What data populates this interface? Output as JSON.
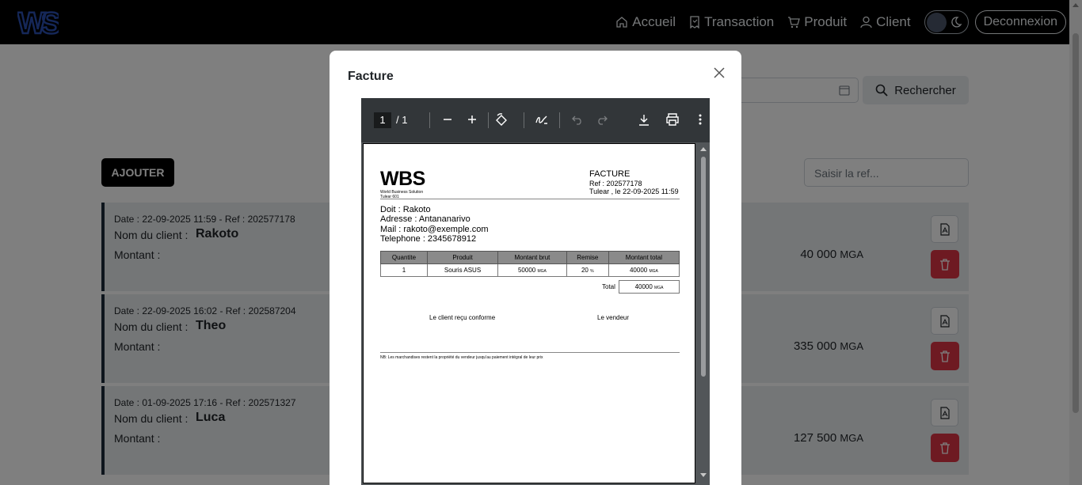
{
  "navbar": {
    "logo_text": "WS",
    "links": [
      {
        "label": "Accueil",
        "icon": "home-icon"
      },
      {
        "label": "Transaction",
        "icon": "receipt-icon"
      },
      {
        "label": "Produit",
        "icon": "cart-icon"
      },
      {
        "label": "Client",
        "icon": "user-icon"
      }
    ],
    "logout_label": "Deconnexion",
    "theme_icon": "moon-icon"
  },
  "filters": {
    "search_button": "Rechercher",
    "ref_placeholder": "Saisir la ref..."
  },
  "add_button": "AJOUTER",
  "labels": {
    "date_prefix": "Date :",
    "ref_prefix": "Ref :",
    "client_label": "Nom du client :",
    "amount_label": "Montant :",
    "currency": "MGA"
  },
  "transactions": [
    {
      "date": "22-09-2025 11:59",
      "ref": "202577178",
      "client": "Rakoto",
      "amount": "40 000"
    },
    {
      "date": "22-09-2025 16:02",
      "ref": "202587204",
      "client": "Theo",
      "amount": "335 000"
    },
    {
      "date": "01-09-2025 17:16",
      "ref": "202571327",
      "client": "Luca",
      "amount": "127 500"
    }
  ],
  "modal": {
    "title": "Facture",
    "viewer": {
      "page_current": "1",
      "page_total": "/  1"
    },
    "invoice": {
      "company": "WBS",
      "company_sub": "World Business Solution",
      "company_city": "Tulear 601",
      "doc_title": "FACTURE",
      "ref_line": "Ref : 202577178",
      "date_line": "Tulear , le 22-09-2025 11:59",
      "doit": "Doit : Rakoto",
      "adresse": "Adresse : Antananarivo",
      "mail": "Mail : rakoto@exemple.com",
      "telephone": "Telephone : 2345678912",
      "columns": [
        "Quantite",
        "Produit",
        "Montant brut",
        "Remise",
        "Montant total"
      ],
      "row": {
        "quantite": "1",
        "produit": "Souris ASUS",
        "brut": "50000",
        "remise": "20",
        "remise_unit": "%",
        "total": "40000",
        "currency": "MGA"
      },
      "total_label": "Total",
      "total_value": "40000",
      "sign_client": "Le client reçu conforme",
      "sign_vendeur": "Le vendeur",
      "note": "NB: Les marchandises restent la propriété du vendeur jusqu'au paiement intégral de leur prix"
    }
  },
  "colors": {
    "navbar_bg": "#000000",
    "accent_blue": "#1f3f8f",
    "delete_red": "#dc3545",
    "card_border": "#1c2a3a"
  }
}
